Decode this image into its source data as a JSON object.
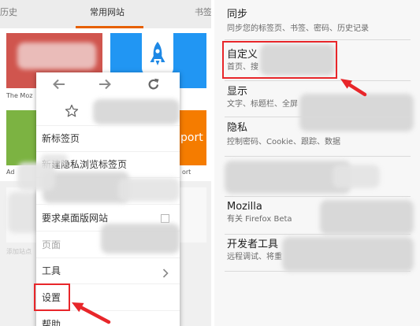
{
  "left_screen": {
    "tabs": [
      {
        "label": "历史",
        "selected": false
      },
      {
        "label": "常用网站",
        "selected": true
      },
      {
        "label": "书签",
        "selected": false
      }
    ],
    "top_sites": {
      "labels": [
        "The Moz",
        "Ad",
        "ort"
      ],
      "tile_text": "port",
      "add_site_label": "添加站点"
    },
    "menu": {
      "nav_icons": [
        "back-arrow-icon",
        "forward-arrow-icon",
        "reload-icon"
      ],
      "bookmark_icon": "star-icon",
      "items": [
        {
          "label": "新标签页"
        },
        {
          "label": "新建隐私浏览标签页"
        },
        {
          "label": "要求桌面版网站",
          "checkbox": true,
          "checked": false
        },
        {
          "label": "页面",
          "disabled": true
        },
        {
          "label": "工具",
          "submenu_icon": "chevron-right-icon"
        },
        {
          "label": "设置",
          "highlighted": true
        },
        {
          "label": "帮助"
        }
      ]
    }
  },
  "right_screen": {
    "settings": [
      {
        "title": "同步",
        "summary": "同步您的标签页、书签、密码、历史记录"
      },
      {
        "title": "自定义",
        "summary": "首页、搜",
        "highlighted": true
      },
      {
        "title": "显示",
        "summary": "文字、标题栏、全屏"
      },
      {
        "title": "隐私",
        "summary": "控制密码、Cookie、跟踪、数据"
      },
      {
        "title": "Mozilla",
        "summary": "有关 Firefox Beta"
      },
      {
        "title": "开发者工具",
        "summary": "远程调试、将重"
      }
    ]
  },
  "colors": {
    "firefox_orange": "#e66000",
    "annotation_red": "#e8262a",
    "tile_red": "#d0554e",
    "tile_blue": "#2196f3",
    "tile_green": "#7cb342",
    "tile_orange": "#f57c00"
  }
}
